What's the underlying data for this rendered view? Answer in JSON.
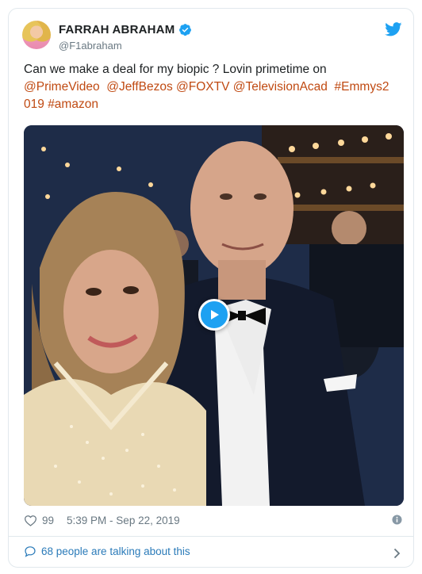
{
  "user": {
    "display_name": "FARRAH ABRAHAM",
    "handle": "@F1abraham",
    "verified": true
  },
  "tweet": {
    "text_plain": "Can we make a deal for my biopic ? Lovin primetime on",
    "links": [
      "@PrimeVideo",
      "@JeffBezos",
      "@FOXTV",
      "@TelevisionAcad",
      "#Emmys2",
      "019",
      "#amazon"
    ],
    "likes": "99",
    "timestamp": "5:39 PM - Sep 22, 2019"
  },
  "footer": {
    "conversation_label": "68 people are talking about this"
  },
  "colors": {
    "link": "#c04a12",
    "meta": "#697882",
    "twitter_blue": "#1da1f2",
    "footer_link": "#2b7bb9"
  },
  "icons": [
    "twitter-bird-icon",
    "verified-badge-icon",
    "play-icon",
    "heart-icon",
    "info-icon",
    "speech-bubble-icon",
    "chevron-right-icon"
  ]
}
